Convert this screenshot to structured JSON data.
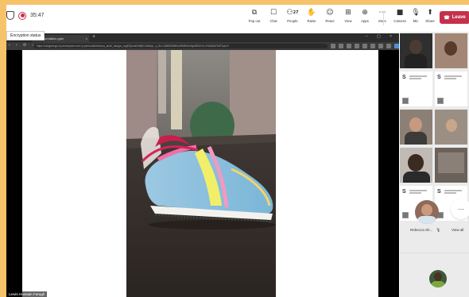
{
  "meeting": {
    "timer": "35:47",
    "encryption_tooltip": "Encryption status"
  },
  "toolbar": {
    "items": [
      {
        "label": "Pop out",
        "icon": "pop-out-icon"
      },
      {
        "label": "Chat",
        "icon": "chat-icon"
      },
      {
        "label": "People",
        "icon": "people-icon",
        "count": "27"
      },
      {
        "label": "Raise",
        "icon": "raise-hand-icon"
      },
      {
        "label": "React",
        "icon": "react-icon"
      },
      {
        "label": "View",
        "icon": "view-icon"
      },
      {
        "label": "Apps",
        "icon": "apps-icon"
      },
      {
        "label": "More",
        "icon": "more-icon"
      },
      {
        "label": "Camera",
        "icon": "camera-icon"
      },
      {
        "label": "Mic",
        "icon": "mic-icon"
      },
      {
        "label": "Share",
        "icon": "share-icon"
      }
    ],
    "leave_label": "Leave"
  },
  "shared_screen": {
    "browser_tab_title": "Presentation.pptx",
    "url": "https://hangarlogo-my.sharepoint.com/:p:/personal/rebecca_shah_hangar_org/EQhmkHdMjYUdNwyL_a_Bl-CLfkB9DBf6fJmRMMGmNp0BSA?e=4%3A6UFMlT&at=9",
    "speaker_name": "Lewis Hussain Faragh"
  },
  "participants": {
    "featured_name": "Rebecca Sh...",
    "view_all_label": "View all"
  },
  "colors": {
    "leave": "#c4314b",
    "background_frame": "#f7c36a"
  }
}
